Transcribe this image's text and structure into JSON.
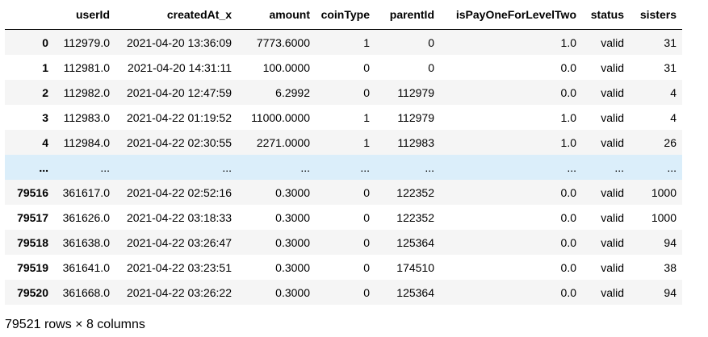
{
  "table": {
    "columns": [
      "userId",
      "createdAt_x",
      "amount",
      "coinType",
      "parentId",
      "isPayOneForLevelTwo",
      "status",
      "sisters"
    ],
    "rows": [
      {
        "index": "0",
        "cells": [
          "112979.0",
          "2021-04-20 13:36:09",
          "7773.6000",
          "1",
          "0",
          "1.0",
          "valid",
          "31"
        ]
      },
      {
        "index": "1",
        "cells": [
          "112981.0",
          "2021-04-20 14:31:11",
          "100.0000",
          "0",
          "0",
          "0.0",
          "valid",
          "31"
        ]
      },
      {
        "index": "2",
        "cells": [
          "112982.0",
          "2021-04-20 12:47:59",
          "6.2992",
          "0",
          "112979",
          "0.0",
          "valid",
          "4"
        ]
      },
      {
        "index": "3",
        "cells": [
          "112983.0",
          "2021-04-22 01:19:52",
          "11000.0000",
          "1",
          "112979",
          "1.0",
          "valid",
          "4"
        ]
      },
      {
        "index": "4",
        "cells": [
          "112984.0",
          "2021-04-22 02:30:55",
          "2271.0000",
          "1",
          "112983",
          "1.0",
          "valid",
          "26"
        ]
      },
      {
        "index": "...",
        "cells": [
          "...",
          "...",
          "...",
          "...",
          "...",
          "...",
          "...",
          "..."
        ]
      },
      {
        "index": "79516",
        "cells": [
          "361617.0",
          "2021-04-22 02:52:16",
          "0.3000",
          "0",
          "122352",
          "0.0",
          "valid",
          "1000"
        ]
      },
      {
        "index": "79517",
        "cells": [
          "361626.0",
          "2021-04-22 03:18:33",
          "0.3000",
          "0",
          "122352",
          "0.0",
          "valid",
          "1000"
        ]
      },
      {
        "index": "79518",
        "cells": [
          "361638.0",
          "2021-04-22 03:26:47",
          "0.3000",
          "0",
          "125364",
          "0.0",
          "valid",
          "94"
        ]
      },
      {
        "index": "79519",
        "cells": [
          "361641.0",
          "2021-04-22 03:23:51",
          "0.3000",
          "0",
          "174510",
          "0.0",
          "valid",
          "38"
        ]
      },
      {
        "index": "79520",
        "cells": [
          "361668.0",
          "2021-04-22 03:26:22",
          "0.3000",
          "0",
          "125364",
          "0.0",
          "valid",
          "94"
        ]
      }
    ]
  },
  "footer": {
    "text": "79521 rows × 8 columns"
  }
}
